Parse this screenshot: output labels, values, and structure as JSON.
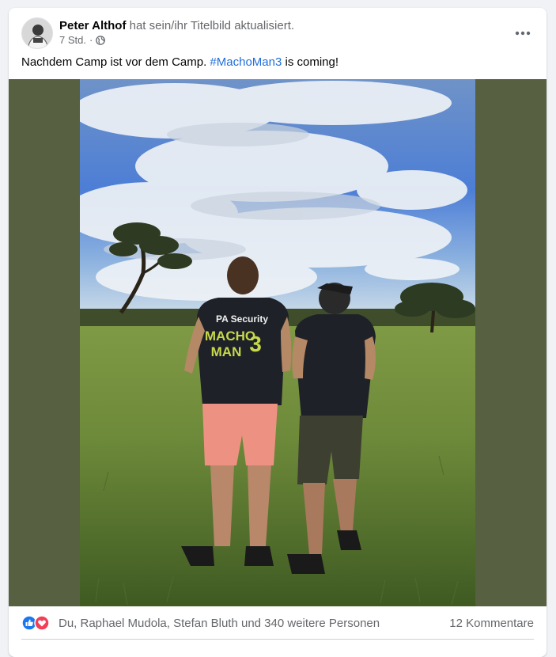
{
  "post": {
    "author_name": "Peter Althof",
    "action_text": " hat sein/ihr Titelbild aktualisiert.",
    "timestamp": "7 Std.",
    "separator": "·",
    "privacy_icon": "globe-icon",
    "more_icon": "more-horizontal-icon",
    "text_before": "Nachdem Camp ist vor dem Camp. ",
    "hashtag": "#MachoMan3",
    "text_after": " is coming!",
    "photo": {
      "shirt_text_line1": "PA Security",
      "shirt_text_line2": "MACHO",
      "shirt_text_line3": "MAN",
      "shirt_text_number": "3"
    }
  },
  "reactions": {
    "icons": [
      "like-icon",
      "love-icon"
    ],
    "names": "Du, Raphael Mudola, Stefan Bluth und 340 weitere Personen",
    "comments": "12 Kommentare"
  },
  "colors": {
    "like_blue": "#1877f2",
    "love_red": "#f33e58",
    "hashtag_blue": "#216fdb",
    "photo_backdrop": "#576041"
  }
}
